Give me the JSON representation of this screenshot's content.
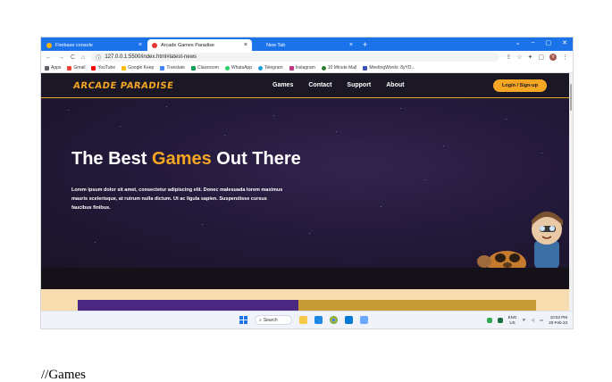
{
  "browser": {
    "tabs": [
      {
        "title": "Firebase console",
        "favicon_color": "#ffb300",
        "active": false
      },
      {
        "title": "Arcade Games Paradise",
        "favicon_color": "#e53935",
        "active": true
      },
      {
        "title": "New Tab",
        "favicon_color": "",
        "active": false
      }
    ],
    "new_tab_label": "+",
    "close_label": "×",
    "window_controls": [
      "⌄",
      "–",
      "▢",
      "✕"
    ],
    "nav": {
      "back": "←",
      "forward": "→",
      "reload": "C",
      "home": "⌂"
    },
    "url": "127.0.0.1:5500/index.html#latest-news",
    "url_info": "ⓘ",
    "toolbar_icons": [
      "⇪",
      "☆",
      "✦",
      "▢"
    ],
    "profile_initial": "V",
    "menu_icon": "⋮",
    "bookmarks": [
      {
        "label": "Apps",
        "color": "#5f6368"
      },
      {
        "label": "Gmail",
        "color": "#ea4335"
      },
      {
        "label": "YouTube",
        "color": "#ff0000"
      },
      {
        "label": "Google Keep",
        "color": "#fbbc04"
      },
      {
        "label": "Translate",
        "color": "#4285f4"
      },
      {
        "label": "Classroom",
        "color": "#0f9d58"
      },
      {
        "label": "WhatsApp",
        "color": "#25d366"
      },
      {
        "label": "Telegram",
        "color": "#229ed9"
      },
      {
        "label": "Instagram",
        "color": "#c13584"
      },
      {
        "label": "10 Minute Mail",
        "color": "#2e7d32"
      },
      {
        "label": "MeetingWords: 8yYD...",
        "color": "#3f51b5"
      }
    ]
  },
  "site": {
    "logo": "ARCADE PARADISE",
    "menu": [
      "Games",
      "Contact",
      "Support",
      "About"
    ],
    "login_label": "Login / Sign-up",
    "hero": {
      "title_before": "The Best ",
      "title_highlight": "Games",
      "title_after": " Out There",
      "text": "Lorem ipsum dolor sit amet, consectetur adipiscing elit. Donec malesuada lorem maximus mauris scelerisque, at rutrum nulla dictum. Ut ac ligula sapien. Suspendisse cursus faucibus finibus."
    }
  },
  "taskbar": {
    "search_label": "Search",
    "lang_top": "ENG",
    "lang_bottom": "US",
    "time": "10:53 PM",
    "date": "20-Feb-23"
  },
  "caption": "//Games",
  "colors": {
    "accent": "#f5a623",
    "browser_blue": "#1a73e8",
    "hero_bg": "#211b32"
  }
}
